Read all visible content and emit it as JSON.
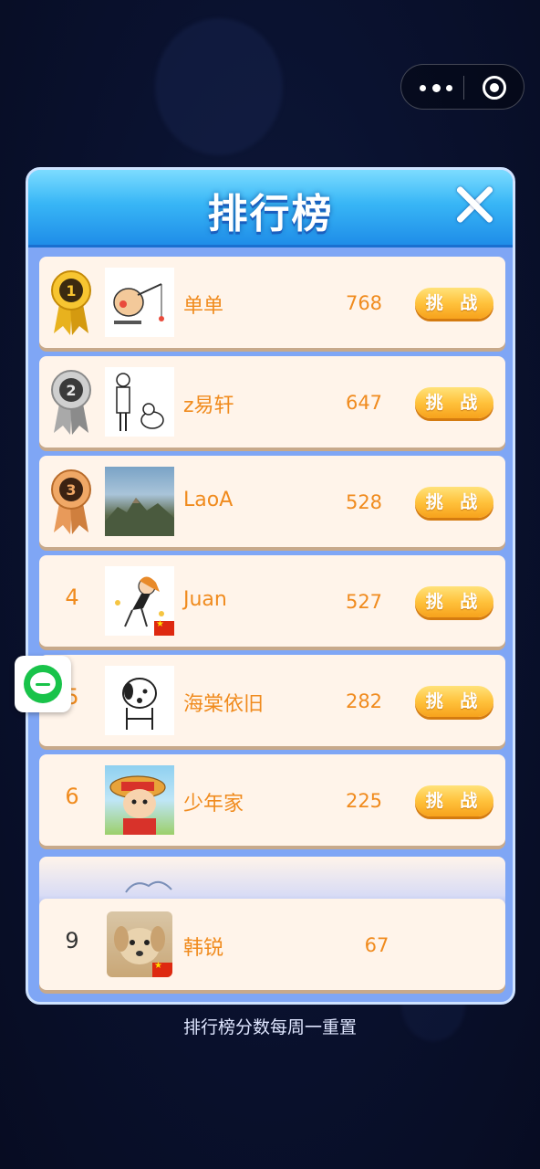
{
  "panel": {
    "title": "排行榜"
  },
  "rows": [
    {
      "rank": "1",
      "name": "单单",
      "score": "768",
      "challenge": "挑 战",
      "medal": "gold"
    },
    {
      "rank": "2",
      "name": "z易轩",
      "score": "647",
      "challenge": "挑 战",
      "medal": "silver"
    },
    {
      "rank": "3",
      "name": "LaoA",
      "score": "528",
      "challenge": "挑 战",
      "medal": "bronze"
    },
    {
      "rank": "4",
      "name": "Juan",
      "score": "527",
      "challenge": "挑 战"
    },
    {
      "rank": "5",
      "name": "海棠依旧",
      "score": "282",
      "challenge": "挑 战"
    },
    {
      "rank": "6",
      "name": "少年家",
      "score": "225",
      "challenge": "挑 战"
    }
  ],
  "self": {
    "rank": "9",
    "name": "韩锐",
    "score": "67"
  },
  "footer": {
    "note": "排行榜分数每周一重置"
  },
  "colors": {
    "accent": "#f08b1e",
    "header": "#38b6f6",
    "button": "#ffc23c",
    "row_bg": "#fff4ea"
  }
}
